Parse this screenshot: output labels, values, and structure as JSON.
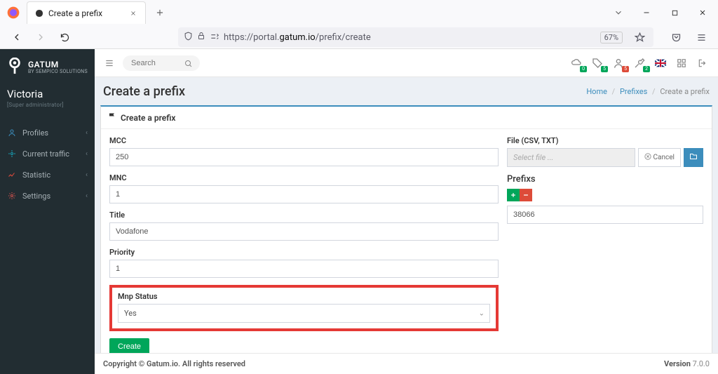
{
  "browser": {
    "tab_title": "Create a prefix",
    "url_prefix": "https://portal.",
    "url_domain": "gatum.io",
    "url_path": "/prefix/create",
    "zoom": "67%"
  },
  "sidebar": {
    "brand_line1": "GATUM",
    "brand_line2": "BY SEMPICO SOLUTIONS",
    "user_name": "Victoria",
    "user_role": "[Super administrator]",
    "items": [
      {
        "label": "Profiles"
      },
      {
        "label": "Current traffic"
      },
      {
        "label": "Statistic"
      },
      {
        "label": "Settings"
      }
    ]
  },
  "topbar": {
    "search_placeholder": "Search",
    "badges": [
      "0",
      "5",
      "5",
      "2"
    ]
  },
  "page": {
    "title": "Create a prefix",
    "panel_title": "Create a prefix",
    "breadcrumbs": {
      "home": "Home",
      "parent": "Prefixes",
      "current": "Create a prefix"
    }
  },
  "form": {
    "mcc": {
      "label": "MCC",
      "value": "250"
    },
    "mnc": {
      "label": "MNC",
      "value": "1"
    },
    "title": {
      "label": "Title",
      "value": "Vodafone"
    },
    "priority": {
      "label": "Priority",
      "value": "1"
    },
    "mnp_status": {
      "label": "Mnp Status",
      "value": "Yes"
    },
    "create_button": "Create"
  },
  "side": {
    "file_label": "File (CSV, TXT)",
    "file_placeholder": "Select file ...",
    "file_cancel": "Cancel",
    "prefixs_title": "Prefixs",
    "prefix_value": "38066"
  },
  "footer": {
    "copyright": "Copyright © Gatum.io. All rights reserved",
    "version_label": "Version",
    "version": "7.0.0"
  }
}
